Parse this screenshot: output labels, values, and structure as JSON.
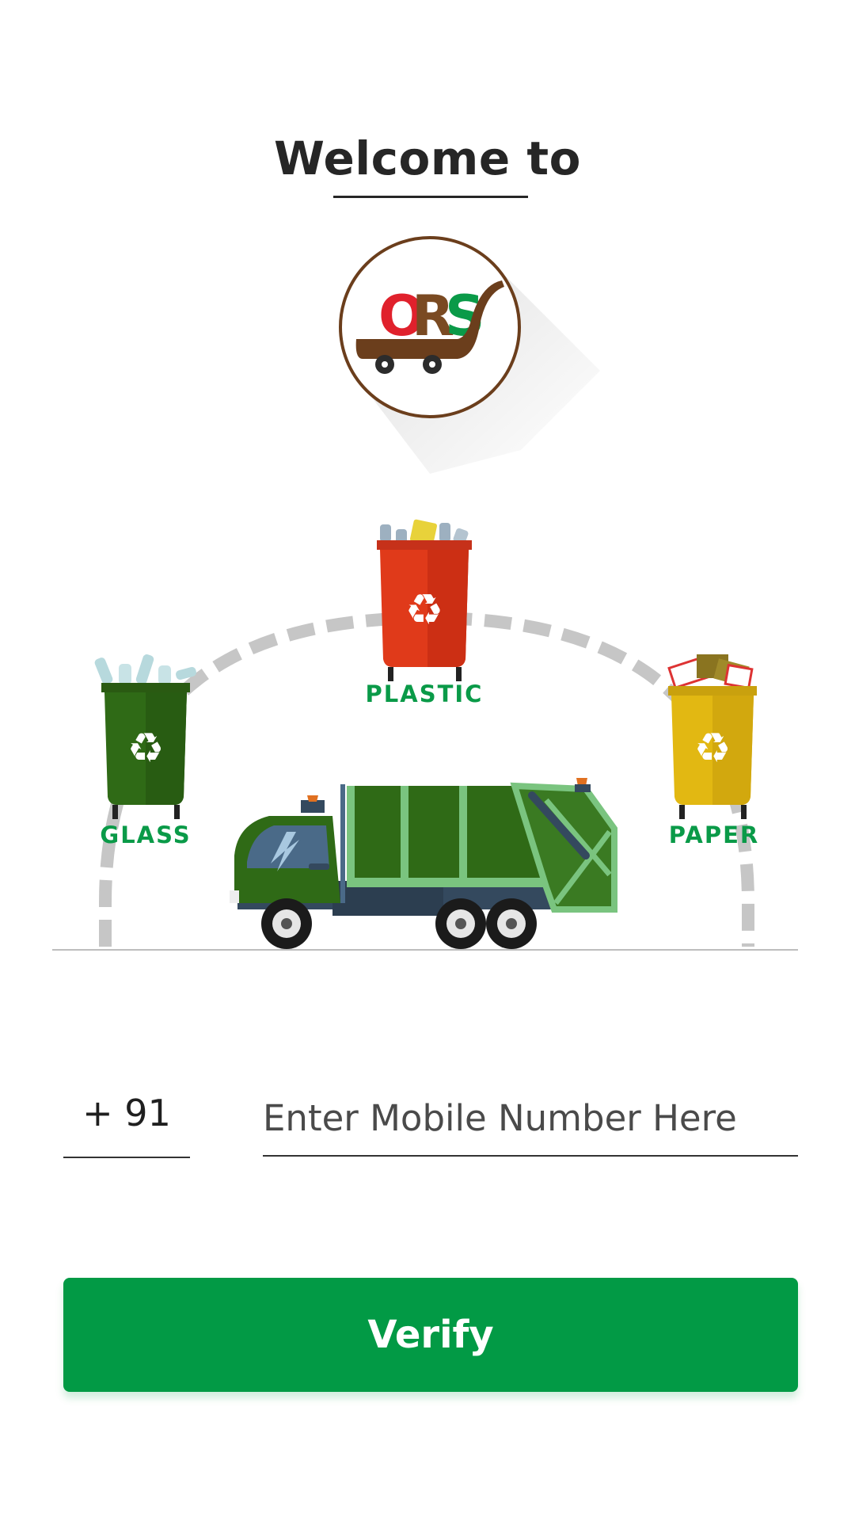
{
  "header": {
    "welcome_text": "Welcome to"
  },
  "logo": {
    "letters": [
      "O",
      "R",
      "S"
    ],
    "letter_colors": [
      "#e0212c",
      "#7a4a22",
      "#0a9a48"
    ],
    "ring_color": "#6b3e1c",
    "cart_color": "#6b3e1c"
  },
  "illustration": {
    "bins": [
      {
        "label": "PLASTIC",
        "color": "#e03a1a",
        "icon": "recycle-icon"
      },
      {
        "label": "GLASS",
        "color": "#2f6a16",
        "icon": "recycle-icon"
      },
      {
        "label": "PAPER",
        "color": "#e2b812",
        "icon": "recycle-icon"
      }
    ],
    "vehicle": "garbage-truck"
  },
  "form": {
    "country_code": "+ 91",
    "mobile_placeholder": "Enter Mobile Number Here",
    "mobile_value": ""
  },
  "actions": {
    "verify_label": "Verify"
  },
  "colors": {
    "accent": "#029a45",
    "label_green": "#0a9a48"
  }
}
